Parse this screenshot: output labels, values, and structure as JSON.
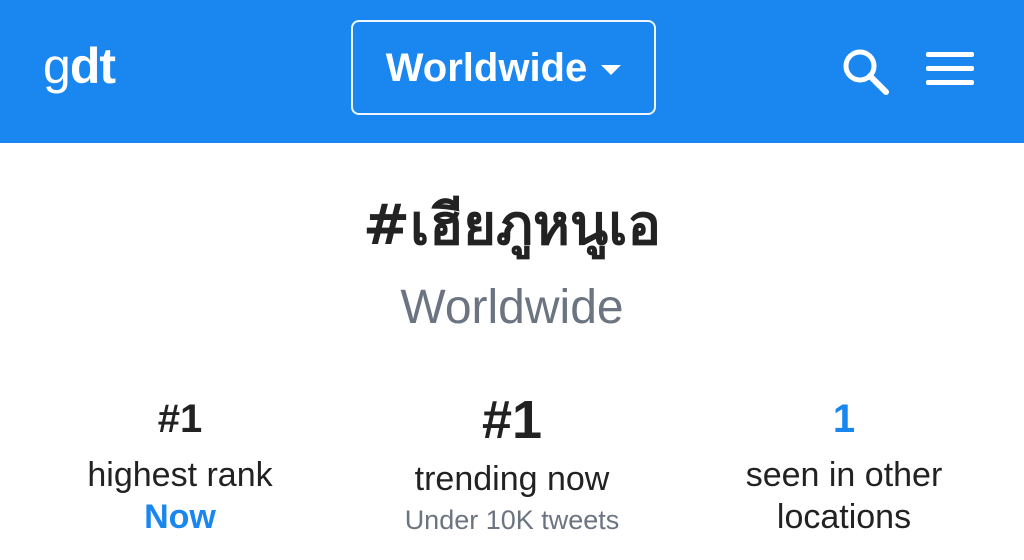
{
  "header": {
    "logo_g": "g",
    "logo_dt": "dt",
    "location_label": "Worldwide",
    "icons": {
      "search": "search-icon",
      "menu": "hamburger-menu-icon",
      "dropdown": "caret-down-icon"
    },
    "colors": {
      "brand_blue": "#1a86f0",
      "text_dark": "#222222",
      "text_grey": "#6b7480"
    }
  },
  "trend": {
    "title": "#เฮียภูหนูเอ",
    "location": "Worldwide"
  },
  "stats": [
    {
      "value": "#1",
      "label": "highest rank",
      "sub": "Now"
    },
    {
      "value": "#1",
      "label": "trending now",
      "sub": "Under 10K tweets"
    },
    {
      "value": "1",
      "label": "seen in other locations",
      "sub": ""
    }
  ]
}
